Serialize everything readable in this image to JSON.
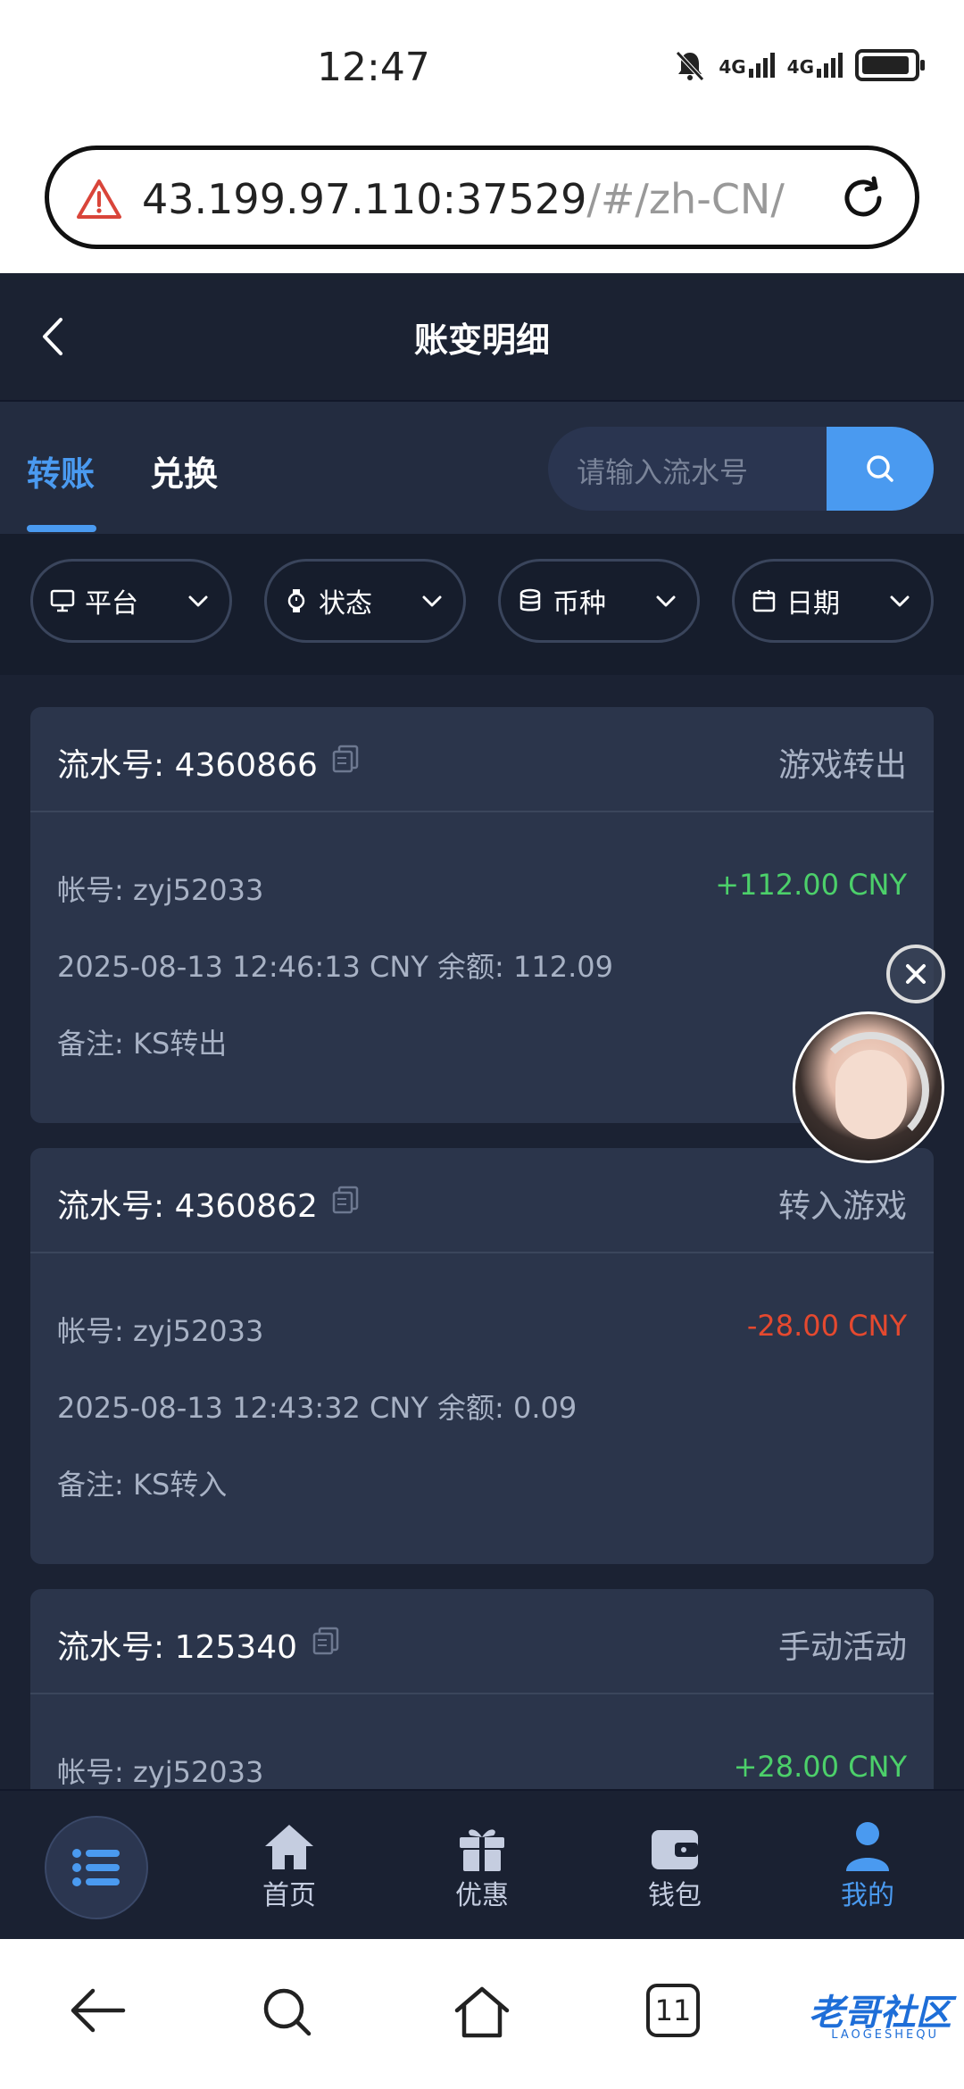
{
  "status_bar": {
    "time": "12:47",
    "net1": "4G",
    "net2": "4G"
  },
  "browser": {
    "url_main": "43.199.97.110:37529",
    "url_rest": "/#/zh-CN/use"
  },
  "header": {
    "title": "账变明细"
  },
  "tabs": [
    {
      "label": "转账",
      "active": true
    },
    {
      "label": "兑换",
      "active": false
    }
  ],
  "search": {
    "placeholder": "请输入流水号"
  },
  "filters": [
    {
      "label": "平台"
    },
    {
      "label": "状态"
    },
    {
      "label": "币种"
    },
    {
      "label": "日期"
    }
  ],
  "records": [
    {
      "serial": "流水号: 4360866",
      "type": "游戏转出",
      "account": "帐号: zyj52033",
      "amount": "+112.00 CNY",
      "detail": "2025-08-13 12:46:13 CNY 余额: 112.09",
      "note": "备注: KS转出"
    },
    {
      "serial": "流水号: 4360862",
      "type": "转入游戏",
      "account": "帐号: zyj52033",
      "amount": "-28.00 CNY",
      "detail": "2025-08-13 12:43:32 CNY 余额: 0.09",
      "note": "备注: KS转入"
    },
    {
      "serial": "流水号: 125340",
      "type": "手动活动",
      "account": "帐号: zyj52033",
      "amount": "+28.00 CNY"
    }
  ],
  "bottom_nav": [
    {
      "label": "首页",
      "icon": "home-icon"
    },
    {
      "label": "优惠",
      "icon": "gift-icon"
    },
    {
      "label": "钱包",
      "icon": "wallet-icon"
    },
    {
      "label": "我的",
      "icon": "user-icon",
      "active": true
    }
  ],
  "system_nav": {
    "tab_count": "11"
  },
  "watermark": {
    "text": "老哥社区",
    "sub": "LAOGESHEQU"
  },
  "colors": {
    "accent": "#4a9af0",
    "positive": "#4cd06a",
    "negative": "#e5492f",
    "background": "#1b2233",
    "card": "#2b354b"
  }
}
